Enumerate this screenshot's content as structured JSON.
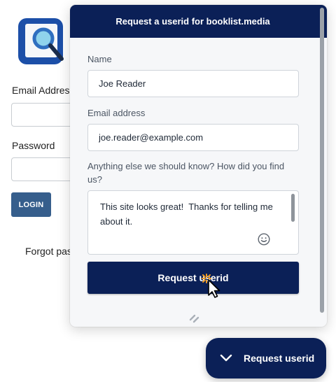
{
  "background_page": {
    "email_label": "Email Address",
    "password_label": "Password",
    "login_button": "LOGIN",
    "forgot_link": "Forgot pas"
  },
  "widget": {
    "title": "Request a userid for booklist.media",
    "fields": {
      "name": {
        "label": "Name",
        "value": "Joe Reader"
      },
      "email": {
        "label": "Email address",
        "value": "joe.reader@example.com"
      },
      "notes": {
        "label": "Anything else we should know? How did you find us?",
        "value": "This site looks great!  Thanks for telling me about it."
      }
    },
    "submit_label": "Request userid"
  },
  "launcher": {
    "label": "Request userid",
    "icon": "chevron-down-icon"
  },
  "colors": {
    "header_navy": "#0b2057",
    "login_button_blue": "#365e8c",
    "cursor_click_orange": "#f39c21"
  }
}
